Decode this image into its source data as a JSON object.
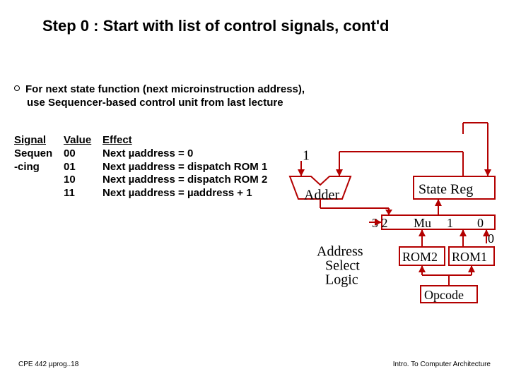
{
  "title": "Step 0 : Start with list of control signals, cont'd",
  "bullet_line1": "For next state function (next microinstruction address),",
  "bullet_line2": "use Sequencer-based control unit from last lecture",
  "table": {
    "headers": {
      "c1": "Signal",
      "c2": "Value",
      "c3": "Effect"
    },
    "rows": [
      {
        "c1": "Sequen",
        "c2": "00",
        "c3": "Next µaddress = 0"
      },
      {
        "c1": "-cing",
        "c2": "01",
        "c3": "Next µaddress = dispatch ROM 1"
      },
      {
        "c1": "",
        "c2": "10",
        "c3": "Next µaddress = dispatch ROM 2"
      },
      {
        "c1": "",
        "c2": "11",
        "c3": "Next  µaddress =  µaddress + 1"
      }
    ]
  },
  "diagram": {
    "adder_in": "1",
    "adder": "Adder",
    "state_reg": "State Reg",
    "mux_left": "3 2",
    "mux": "Mu",
    "mux_mid": "1",
    "mux_right": "0",
    "rom2": "ROM2",
    "rom1": "ROM1",
    "zero": "0",
    "opcode": "Opcode",
    "asl1": "Address",
    "asl2": "Select",
    "asl3": "Logic"
  },
  "footer_left": "CPE 442  µprog..18",
  "footer_right": "Intro. To Computer Architecture"
}
